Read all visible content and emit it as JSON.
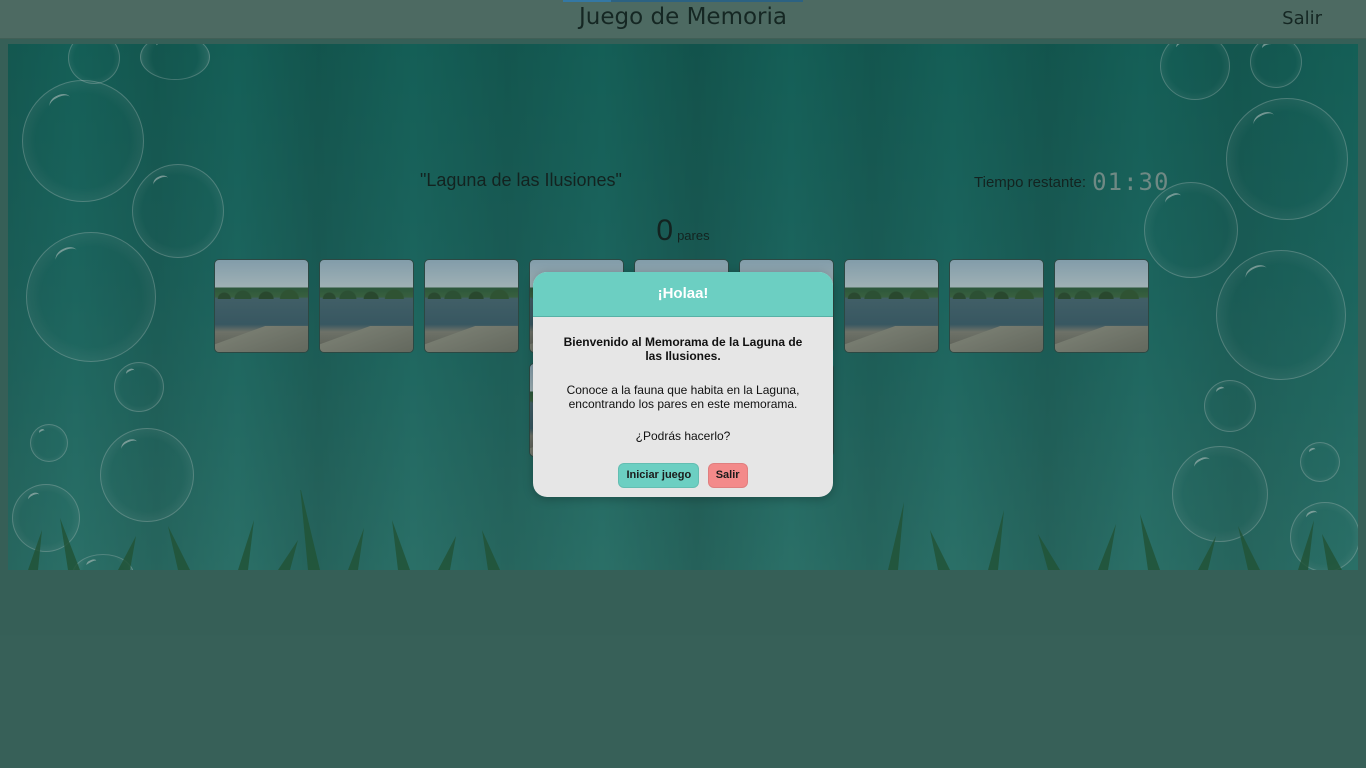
{
  "header": {
    "title": "Juego de Memoria",
    "exit_label": "Salir"
  },
  "game": {
    "title": "\"Laguna de las Ilusiones\"",
    "timer_label": "Tiempo restante:",
    "timer_value": "01:30",
    "pairs_count": "0",
    "pairs_label": "pares"
  },
  "modal": {
    "title": "¡Holaa!",
    "welcome": "Bienvenido al Memorama de la Laguna de las Ilusiones.",
    "intro": "Conoce a la fauna que habita en la Laguna, encontrando los pares en este memorama.",
    "question": "¿Podrás hacerlo?",
    "start_label": "Iniciar juego",
    "exit_label": "Salir"
  },
  "colors": {
    "accent": "#6ccfc2",
    "danger": "#f38a8a",
    "background": "#3d6b62"
  }
}
